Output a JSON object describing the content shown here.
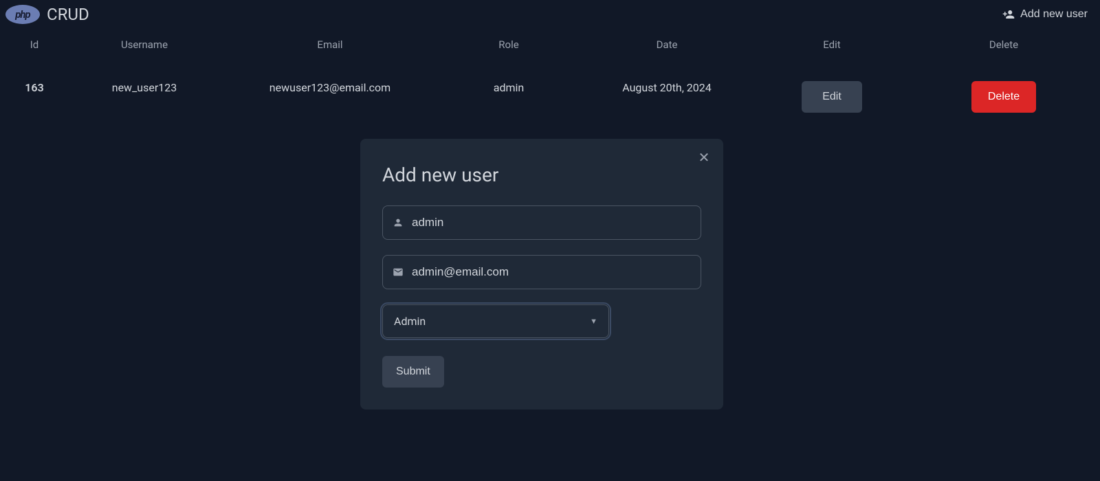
{
  "brand": {
    "logo_text": "php",
    "title": "CRUD"
  },
  "header": {
    "add_user_label": "Add new user"
  },
  "table": {
    "headers": {
      "id": "Id",
      "username": "Username",
      "email": "Email",
      "role": "Role",
      "date": "Date",
      "edit": "Edit",
      "delete": "Delete"
    },
    "rows": [
      {
        "id": "163",
        "username": "new_user123",
        "email": "newuser123@email.com",
        "role": "admin",
        "date": "August 20th, 2024",
        "edit_label": "Edit",
        "delete_label": "Delete"
      }
    ]
  },
  "modal": {
    "title": "Add new user",
    "username_value": "admin",
    "email_value": "admin@email.com",
    "role_selected": "Admin",
    "submit_label": "Submit"
  }
}
